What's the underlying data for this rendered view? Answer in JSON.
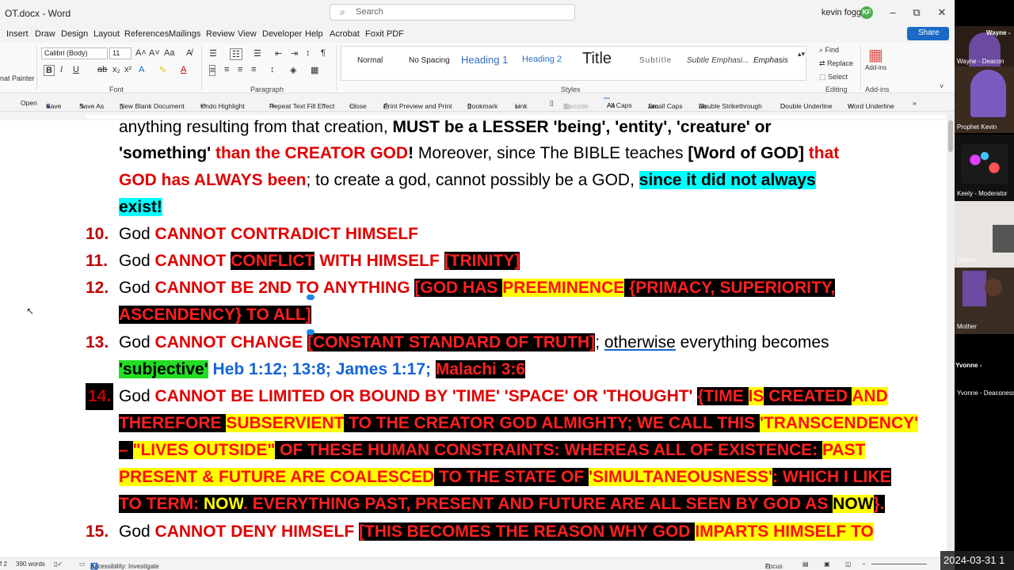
{
  "titlebar": {
    "doc_name": "OT.docx  -  Word",
    "search_placeholder": "Search",
    "user_name": "kevin foggie",
    "user_initials": "KF",
    "minimize": "–",
    "restore": "⧉",
    "close": "✕"
  },
  "tabs": [
    "Insert",
    "Draw",
    "Design",
    "Layout",
    "References",
    "Mailings",
    "Review",
    "View",
    "Developer",
    "Help",
    "Acrobat",
    "Foxit PDF"
  ],
  "share_label": "Share",
  "ribbon": {
    "clipboard_label": "nat Painter",
    "font_name": "Calibri (Body)",
    "font_size": "11",
    "font_group": "Font",
    "paragraph_group": "Paragraph",
    "styles_group": "Styles",
    "editing_group": "Editing",
    "addins_group": "Add-ins",
    "styles": [
      "Normal",
      "No Spacing",
      "Heading 1",
      "Heading 2",
      "Title",
      "Subtitle",
      "Subtle Emphasi...",
      "Emphasis"
    ],
    "find": "Find",
    "replace": "Replace",
    "select": "Select",
    "addins": "Add-ins"
  },
  "qat": [
    "Open",
    "Save",
    "Save As",
    "New Blank Document",
    "Undo Highlight",
    "Repeat Text Fill Effect",
    "Close",
    "Print Preview and Print",
    "Bookmark",
    "Link",
    "Barcode",
    "All Caps",
    "Small Caps",
    "Double Strikethrough",
    "Double Underline",
    "Word Underline"
  ],
  "document": {
    "line0": {
      "a": "anything resulting from that creation, ",
      "b": "MUST be a LESSER 'being', 'entity', 'creature' or"
    },
    "line1": {
      "a": "'something'",
      "b": " than the CREATOR GOD",
      "c": "!",
      "d": "  Moreover, since The BIBLE teaches ",
      "e": "[Word of GOD]",
      "f": " that"
    },
    "line2": {
      "a": "GOD has ALWAYS been",
      "b": "; to create a god, cannot possibly be a GOD, ",
      "c": "since it did not always"
    },
    "line3": {
      "a": "exist!"
    },
    "item10": {
      "num": "10.",
      "a": "God ",
      "b": "CANNOT CONTRADICT HIMSELF"
    },
    "item11": {
      "num": "11.",
      "a": "God ",
      "b": "CANNOT ",
      "c": "CONFLICT",
      "d": " WITH HIMSELF ",
      "e": "[TRINITY]"
    },
    "item12": {
      "num": "12.",
      "a": "God ",
      "b": "CANNOT BE 2ND TO ANYTHING ",
      "c": "[GOD HAS ",
      "d": "PREEMINENCE",
      "e": " {PRIMACY, SUPERIORITY,",
      "f": "ASCENDENCY} TO ALL]"
    },
    "item13": {
      "num": "13.",
      "a": "God ",
      "b": "CANNOT CHANGE ",
      "c": "[CONSTANT STANDARD OF TRUTH]",
      "d": "; ",
      "e": "otherwise",
      "f": " everything becomes",
      "g": "'subjective'",
      "h": " Heb 1:12; 13:8; James 1:17; ",
      "i": "Malachi 3:6"
    },
    "item14": {
      "num": "14.",
      "a": "God ",
      "b": "CANNOT BE LIMITED OR BOUND BY 'TIME' 'SPACE' OR 'THOUGHT' ",
      "c": "{TIME ",
      "d": "IS",
      "e": " CREATED ",
      "f": "AND",
      "g": "THEREFORE ",
      "h": "SUBSERVIENT",
      "i": " TO THE CREATOR GOD ALMIGHTY; WE CALL THIS ",
      "j": "'TRANSCENDENCY'",
      "k": " – ",
      "l": "\"LIVES OUTSIDE\"",
      "m": " OF THESE HUMAN CONSTRAINTS: WHEREAS ALL OF EXISTENCE: ",
      "n": "PAST",
      "o": "PRESENT & FUTURE ARE COALESCED",
      "p": " TO THE STATE OF ",
      "q": "'SIMULTANEOUSNESS'",
      "r": ": WHICH I LIKE",
      "s": "TO TERM: ",
      "t": "NOW",
      "u": ".  EVERYTHING PAST, PRESENT AND FUTURE ARE ALL SEEN BY GOD AS ",
      "v": "NOW",
      "w": "}."
    },
    "item15": {
      "num": "15.",
      "a": "God ",
      "b": "CANNOT DENY HIMSELF ",
      "c": "[THIS BECOMES THE REASON WHY GOD ",
      "d": "IMPARTS HIMSELF TO"
    }
  },
  "status": {
    "page": "f 2",
    "words": "390 words",
    "accessibility": "Accessibility: Investigate",
    "focus": "Focus"
  },
  "video": {
    "tiles": [
      {
        "top": "Wayne -",
        "name": "Wayne - Deacon"
      },
      {
        "top": "",
        "name": "Prophet Kevin"
      },
      {
        "top": "",
        "name": "Keely - Moderator"
      },
      {
        "top": "",
        "name": "Donna"
      },
      {
        "top": "",
        "name": "Mother"
      },
      {
        "top": "Yvonne -",
        "name": "Yvonne - Deaconess"
      }
    ]
  },
  "timestamp": "2024-03-31 1",
  "colors": {
    "accent": "#1b6ac6",
    "red_text": "#e00000",
    "highlight_cyan": "#00ffff",
    "highlight_yellow": "#ffff00",
    "highlight_green": "#22dd22"
  }
}
